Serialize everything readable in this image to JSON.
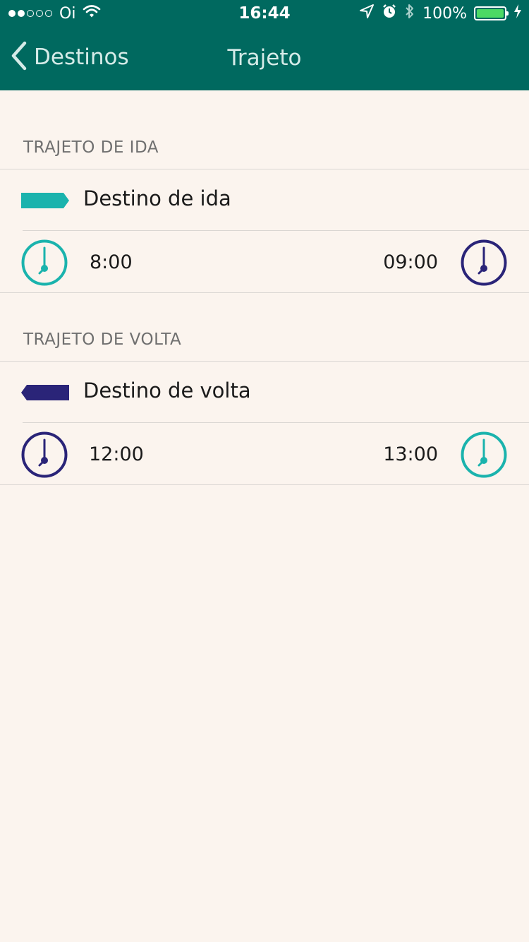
{
  "status_bar": {
    "carrier": "Oi",
    "time": "16:44",
    "battery": "100%",
    "battery_level": 1.0
  },
  "nav": {
    "back_label": "Destinos",
    "title": "Trajeto"
  },
  "sections": [
    {
      "title": "TRAJETO DE IDA",
      "destination": "Destino de ida",
      "flag_color": "#1ab3ad",
      "start_time": "8:00",
      "end_time": "09:00",
      "start_clock_color": "#1ab3ad",
      "end_clock_color": "#2a2478"
    },
    {
      "title": "TRAJETO DE VOLTA",
      "destination": "Destino de volta",
      "flag_color": "#2a2478",
      "start_time": "12:00",
      "end_time": "13:00",
      "start_clock_color": "#2a2478",
      "end_clock_color": "#1ab3ad"
    }
  ],
  "colors": {
    "header": "#00695f",
    "background": "#fbf4ee",
    "teal": "#1ab3ad",
    "navy": "#2a2478"
  },
  "icons": [
    "back-chevron-icon",
    "wifi-icon",
    "location-arrow-icon",
    "alarm-icon",
    "bluetooth-icon",
    "charging-bolt-icon",
    "clock-icon",
    "route-flag-icon"
  ]
}
